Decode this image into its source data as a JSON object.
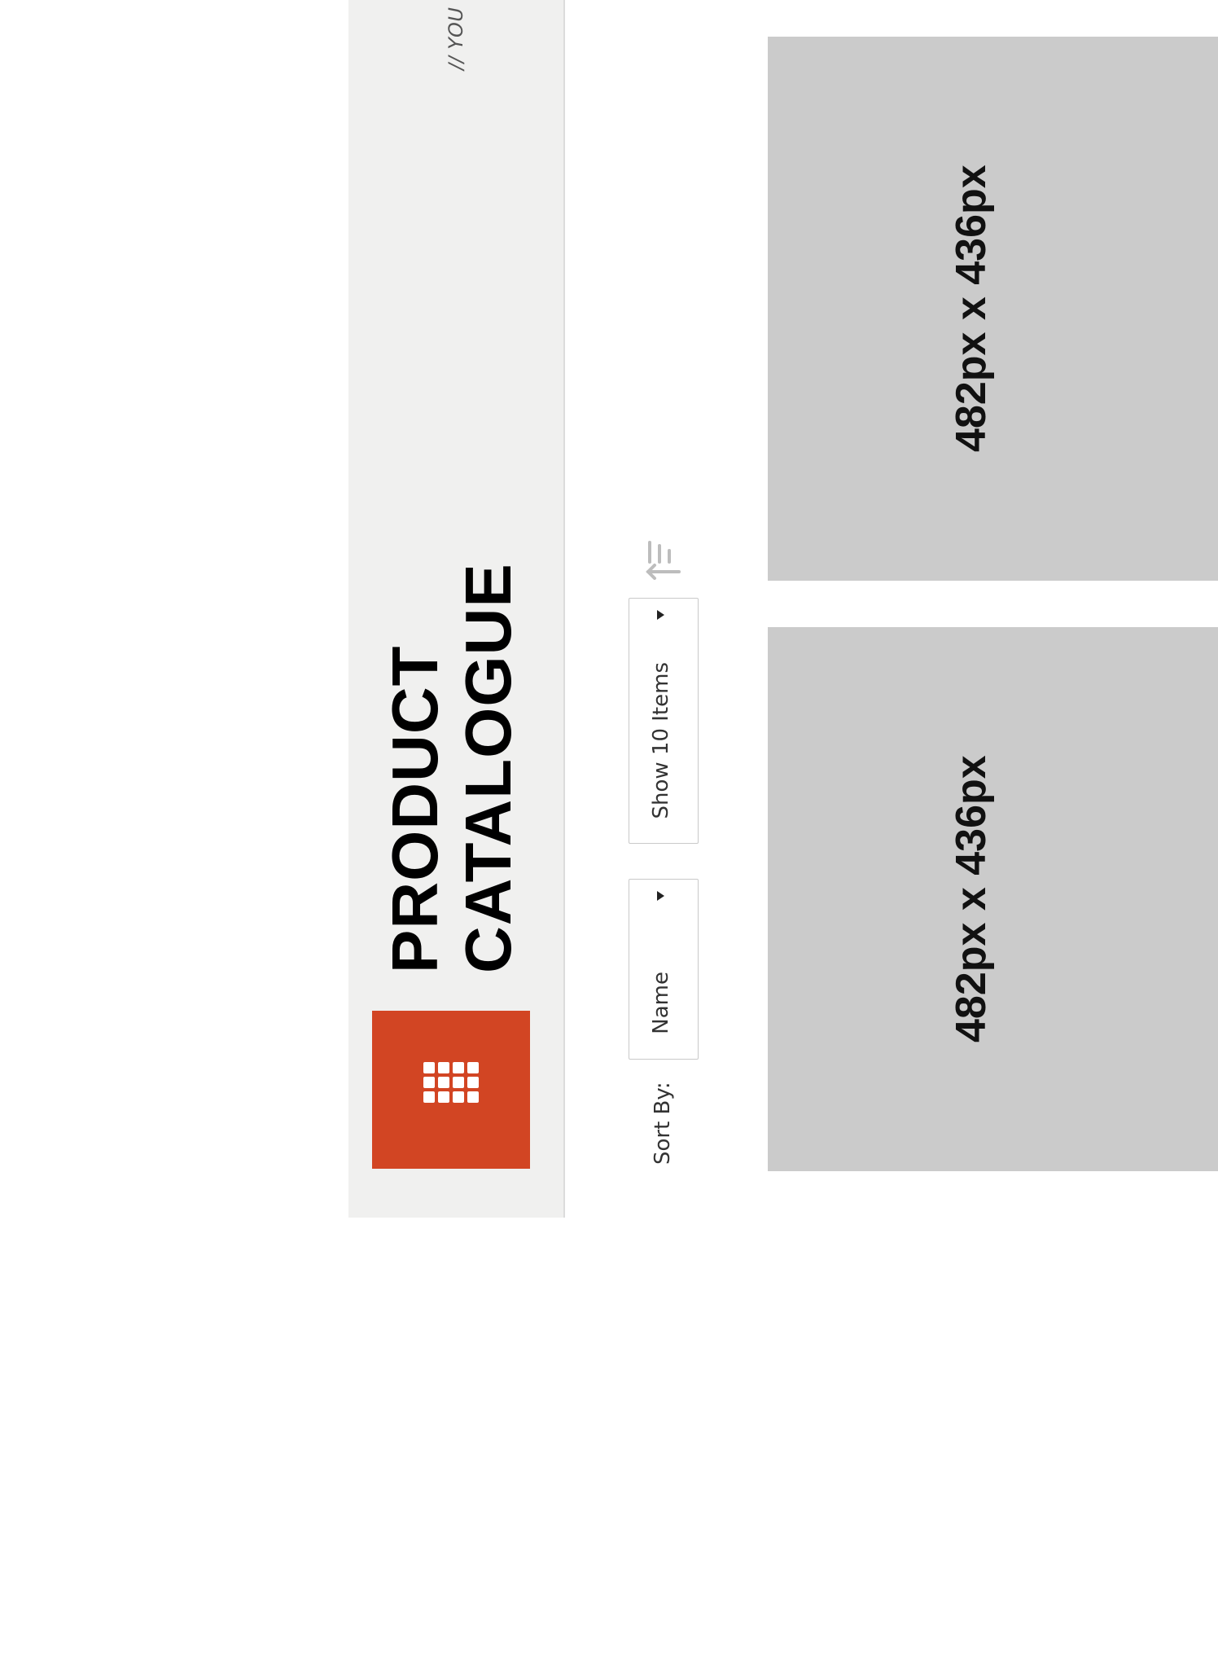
{
  "header": {
    "title_line_1": "PRODUCT",
    "title_line_2": "CATALOGUE",
    "tagline": "// YOU",
    "logo_icon": "grid-icon",
    "colors": {
      "logo_background": "#d24523",
      "header_background": "#f0f0ef"
    }
  },
  "controls": {
    "sort_label": "Sort By:",
    "sort_select": {
      "selected": "Name"
    },
    "show_select": {
      "selected": "Show 10 Items"
    },
    "sort_order_icon": "sort-order-icon"
  },
  "products": [
    {
      "placeholder_label": "482px x 436px"
    },
    {
      "placeholder_label": "482px x 436px"
    }
  ]
}
